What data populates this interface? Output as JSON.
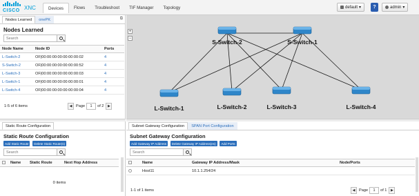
{
  "header": {
    "logo_text": "CISCO",
    "app_name": "XNC",
    "nav_tabs": [
      "Devices",
      "Flows",
      "Troubleshoot",
      "TIF Manager",
      "Topology"
    ],
    "active_tab": "Devices",
    "profile_label": "default",
    "help_label": "?",
    "user_label": "admin"
  },
  "nodes_panel": {
    "tabs": [
      "Nodes Learned",
      "onePK"
    ],
    "title": "Nodes Learned",
    "search_placeholder": "Search",
    "columns": [
      "Node Name",
      "Node ID",
      "Ports"
    ],
    "rows": [
      {
        "name": "L-Switch-2",
        "id": "OF|00:00:00:00:00:00:00:02",
        "ports": "4"
      },
      {
        "name": "S-Switch-2",
        "id": "OF|00:00:00:00:00:00:00:52",
        "ports": "4"
      },
      {
        "name": "L-Switch-3",
        "id": "OF|00:00:00:00:00:00:00:03",
        "ports": "4"
      },
      {
        "name": "L-Switch-1",
        "id": "OF|00:00:00:00:00:00:00:01",
        "ports": "4"
      },
      {
        "name": "L-Switch-4",
        "id": "OF|00:00:00:00:00:00:00:04",
        "ports": "4"
      }
    ],
    "summary": "1-5 of 6 items",
    "page_label": "Page",
    "page_value": "1",
    "page_of": "of 2"
  },
  "topology": {
    "switches": [
      {
        "name": "S-Switch-2"
      },
      {
        "name": "S-Switch-1"
      },
      {
        "name": "L-Switch-1"
      },
      {
        "name": "L-Switch-2"
      },
      {
        "name": "L-Switch-3"
      },
      {
        "name": "L-Switch-4"
      }
    ],
    "zoom_in": "+",
    "zoom_out": "−"
  },
  "static_route": {
    "tab": "Static Route Configuration",
    "title": "Static Route Configuration",
    "buttons": [
      "Add Static Route",
      "Delete Static Route(s)"
    ],
    "search_placeholder": "Search",
    "columns": [
      "Name",
      "Static Route",
      "Next Hop Address"
    ],
    "empty_text": "0 items"
  },
  "subnet": {
    "tabs": [
      "Subnet Gateway Configuration",
      "SPAN Port Configuration"
    ],
    "title": "Subnet Gateway Configuration",
    "buttons": [
      "Add Gateway IP Address",
      "Delete Gateway IP Address(es)",
      "Add Ports"
    ],
    "search_placeholder": "Search",
    "columns": [
      "Name",
      "Gateway IP Address/Mask",
      "Node/Ports"
    ],
    "rows": [
      {
        "name": "Host11",
        "gateway": "10.1.1.254/24",
        "ports": ""
      }
    ],
    "summary": "1-1 of 1 items",
    "page_label": "Page",
    "page_value": "1",
    "page_of": "of 1"
  },
  "colors": {
    "accent": "#049fd9",
    "link": "#2a6ebb",
    "button": "#2a6ebb",
    "canvas": "#d9d9d9"
  }
}
